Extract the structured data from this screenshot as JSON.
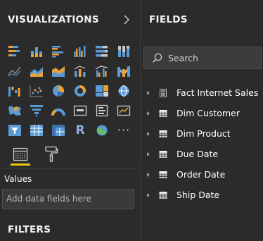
{
  "visualizations": {
    "title": "VISUALIZATIONS",
    "collapse_icon": "chevron-right-icon",
    "visual_icons": [
      "stacked-bar-chart-icon",
      "stacked-column-chart-icon",
      "clustered-bar-chart-icon",
      "clustered-column-chart-icon",
      "100-stacked-bar-chart-icon",
      "100-stacked-column-chart-icon",
      "line-chart-icon",
      "area-chart-icon",
      "stacked-area-chart-icon",
      "line-and-stacked-column-chart-icon",
      "line-and-clustered-column-chart-icon",
      "ribbon-chart-icon",
      "waterfall-chart-icon",
      "scatter-chart-icon",
      "pie-chart-icon",
      "donut-chart-icon",
      "treemap-icon",
      "map-icon",
      "filled-map-icon",
      "funnel-icon",
      "gauge-icon",
      "card-icon",
      "multi-row-card-icon",
      "kpi-icon",
      "slicer-icon",
      "table-icon",
      "matrix-icon",
      "r-script-visual-icon",
      "arcgis-globe-icon",
      "more-visuals-icon"
    ],
    "r_label": "R",
    "more_label": "···",
    "tools": {
      "fields_icon": "fields-well-icon",
      "format_icon": "paint-roller-icon"
    },
    "values_label": "Values",
    "values_placeholder": "Add data fields here",
    "filters_title": "FILTERS"
  },
  "fields": {
    "title": "FIELDS",
    "search_placeholder": "Search",
    "search_icon": "search-icon",
    "tables": [
      {
        "name": "Fact Internet Sales",
        "icon": "fact-table-icon"
      },
      {
        "name": "Dim Customer",
        "icon": "table-icon"
      },
      {
        "name": "Dim Product",
        "icon": "table-icon"
      },
      {
        "name": "Due Date",
        "icon": "table-icon"
      },
      {
        "name": "Order Date",
        "icon": "table-icon"
      },
      {
        "name": "Ship Date",
        "icon": "table-icon"
      }
    ]
  },
  "colors": {
    "background": "#2b2b2b",
    "accent_yellow": "#f2c80f",
    "icon_blue": "#5b9bd5",
    "icon_orange": "#e8a23a",
    "text": "#ffffff",
    "muted_text": "#b8b8b8"
  }
}
